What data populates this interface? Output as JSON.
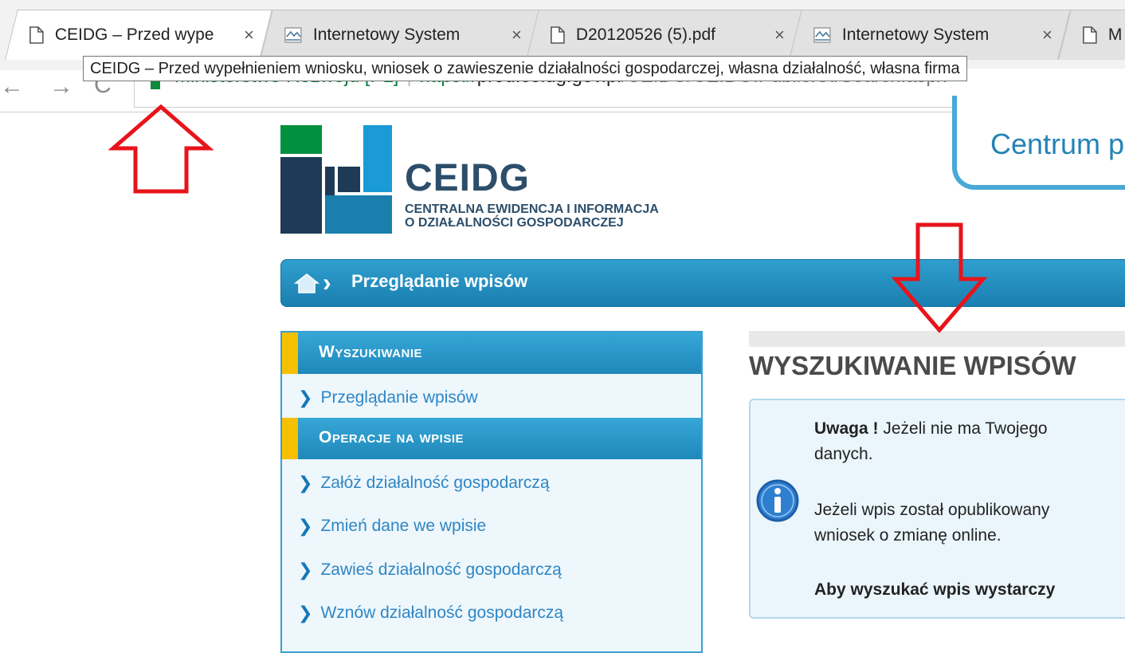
{
  "browser": {
    "tabs": [
      {
        "title": "CEIDG – Przed wype",
        "icon": "page-icon",
        "active": true
      },
      {
        "title": "Internetowy System",
        "icon": "isap-icon",
        "active": false
      },
      {
        "title": "D20120526 (5).pdf",
        "icon": "page-icon",
        "active": false
      },
      {
        "title": "Internetowy System",
        "icon": "isap-icon",
        "active": false
      },
      {
        "title": "M",
        "icon": "page-icon",
        "active": false
      }
    ],
    "tab_close": "×",
    "tooltip": "CEIDG – Przed wypełnieniem wniosku, wniosek o zawieszenie działalności gospodarczej, własna działalność, własna firma",
    "back_glyph": "←",
    "forward_glyph": "→",
    "reload_glyph": "C",
    "secure_name": "Ministerstwo Rozwoju [PL]",
    "separator": "|",
    "url_scheme": "https://",
    "url_host": "prod.ceidg.gov.pl",
    "url_path": "/CEIDG/CEIDG.Public.UI/Search.aspx",
    "annotation_color": "#e8141b"
  },
  "page": {
    "logo_title": "CEIDG",
    "logo_sub_1": "CENTRALNA EWIDENCJA I INFORMACJA",
    "logo_sub_2": "O DZIAŁALNOŚCI GOSPODARCZEJ",
    "centrum_label": "Centrum p",
    "breadcrumb": "Przeglądanie wpisów",
    "sidebar": {
      "search_header": "Wyszukiwanie",
      "search_items": [
        "Przeglądanie wpisów"
      ],
      "ops_header": "Operacje na wpisie",
      "ops_items": [
        "Załóż działalność gospodarczą",
        "Zmień dane we wpisie",
        "Zawieś działalność gospodarczą",
        "Wznów działalność gospodarczą"
      ]
    },
    "main": {
      "heading": "WYSZUKIWANIE WPISÓW",
      "uwaga_label": "Uwaga !",
      "uwaga_text": " Jeżeli nie ma Twojego",
      "uwaga_text_2": "danych.",
      "info_text_1": "Jeżeli wpis został opublikowany",
      "info_text_2": "wniosek o zmianę online.",
      "bold_text": "Aby wyszukać wpis wystarczy"
    },
    "colors": {
      "brand_blue": "#1f8bc0",
      "accent_yellow": "#f6c000",
      "logo_green": "#00903e",
      "logo_navy": "#1e3a56"
    }
  }
}
